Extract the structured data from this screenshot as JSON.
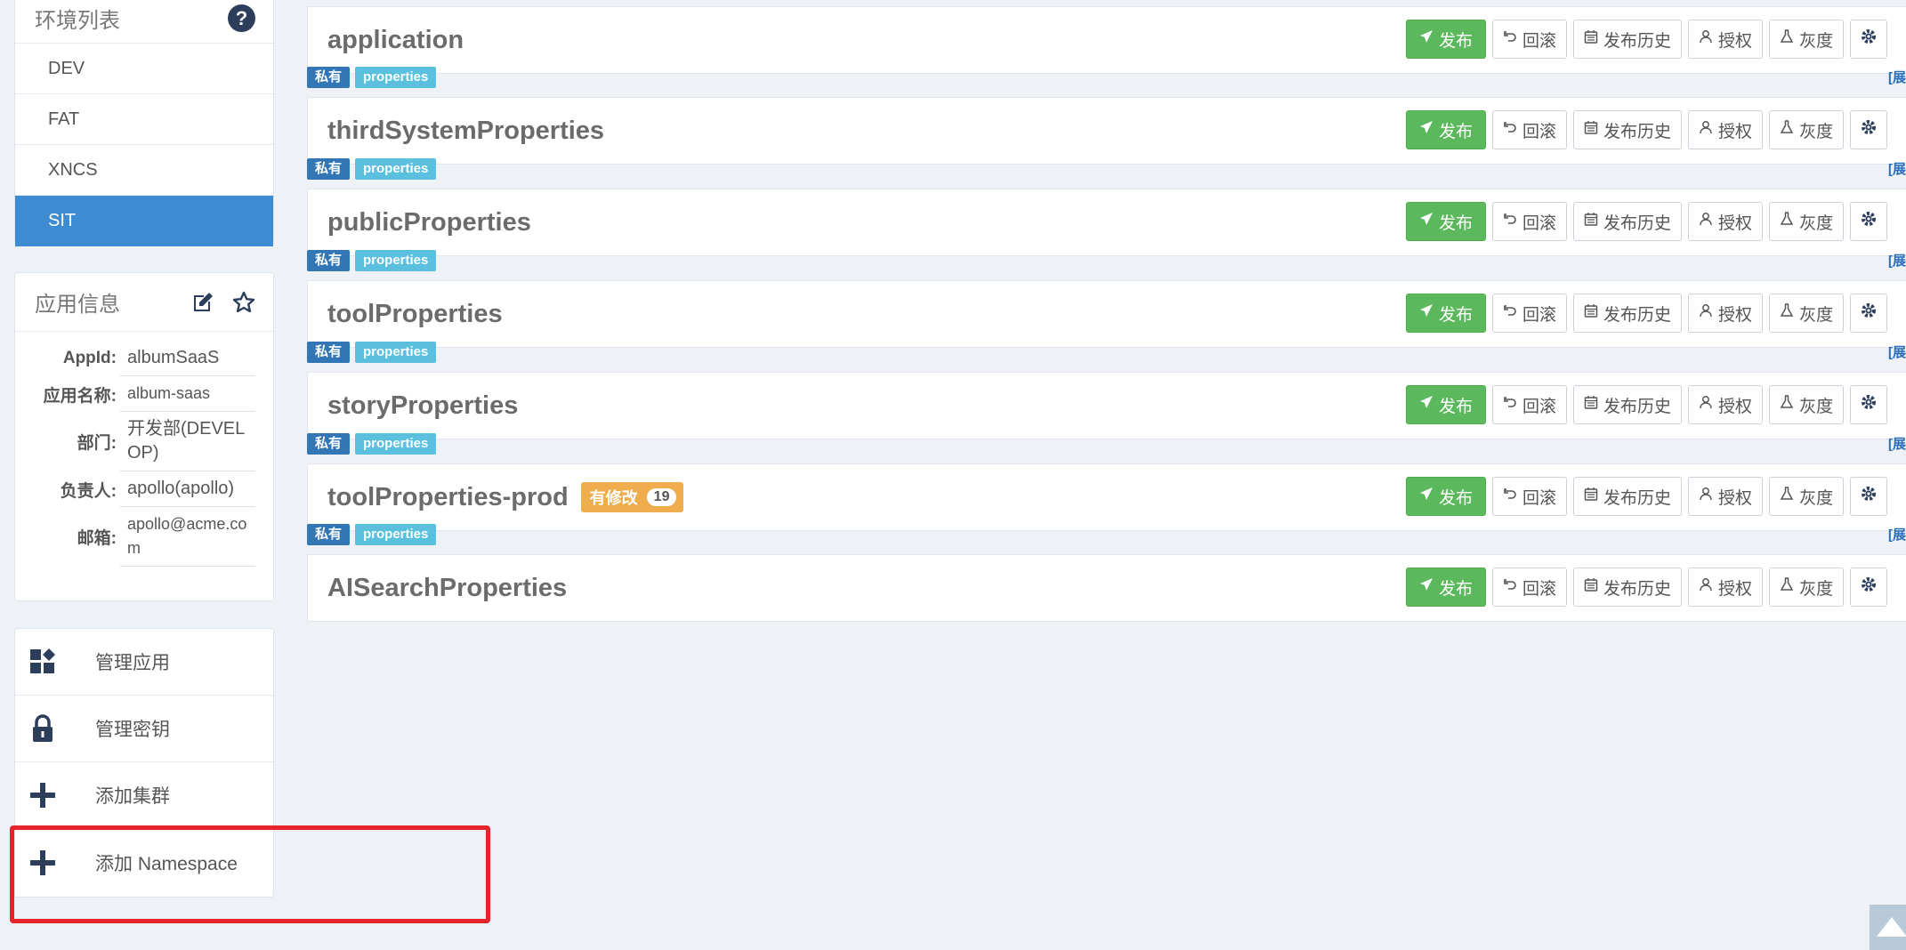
{
  "sidebar": {
    "env_panel": {
      "title": "环境列表",
      "items": [
        {
          "label": "DEV",
          "active": false
        },
        {
          "label": "FAT",
          "active": false
        },
        {
          "label": "XNCS",
          "active": false
        },
        {
          "label": "SIT",
          "active": true
        }
      ]
    },
    "app_info": {
      "title": "应用信息",
      "rows": [
        {
          "label": "AppId:",
          "value": "albumSaaS"
        },
        {
          "label": "应用名称:",
          "value": "album-saas"
        },
        {
          "label": "部门:",
          "value": "开发部(DEVELOP)"
        },
        {
          "label": "负责人:",
          "value": "apollo(apollo)"
        },
        {
          "label": "邮箱:",
          "value": "apollo@acme.com"
        }
      ]
    },
    "menu": [
      {
        "label": "管理应用",
        "icon": "grid-icon"
      },
      {
        "label": "管理密钥",
        "icon": "lock-icon"
      },
      {
        "label": "添加集群",
        "icon": "plus-icon"
      },
      {
        "label": "添加 Namespace",
        "icon": "plus-icon"
      }
    ]
  },
  "namespace_tags": {
    "private": "私有",
    "format": "properties",
    "expand": "[展"
  },
  "namespaces": [
    {
      "name": "application",
      "modified": null
    },
    {
      "name": "thirdSystemProperties",
      "modified": null
    },
    {
      "name": "publicProperties",
      "modified": null
    },
    {
      "name": "toolProperties",
      "modified": null
    },
    {
      "name": "storyProperties",
      "modified": null
    },
    {
      "name": "toolProperties-prod",
      "modified": {
        "label": "有修改",
        "count": "19"
      }
    },
    {
      "name": "AISearchProperties",
      "modified": null
    }
  ],
  "actions": {
    "publish": "发布",
    "rollback": "回滚",
    "history": "发布历史",
    "grant": "授权",
    "gray": "灰度"
  },
  "colors": {
    "active_env": "#3d8bd1",
    "publish": "#5cb85c",
    "tag_private": "#3276b5",
    "tag_format": "#5bc0de",
    "modified": "#f0ad4e",
    "highlight": "#e5242b"
  }
}
